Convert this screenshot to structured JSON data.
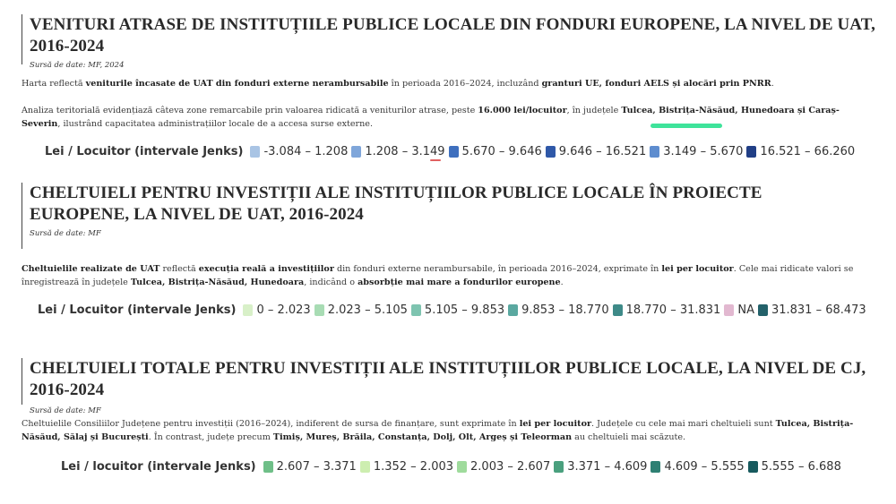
{
  "s1": {
    "title": "VENITURI ATRASE DE INSTITUȚIILE PUBLICE LOCALE DIN FONDURI EUROPENE, LA NIVEL DE UAT, 2016-2024",
    "source": "Sursă de date: MF, 2024",
    "p1": [
      "Harta reflectă ",
      "veniturile încasate de UAT din fonduri externe nerambursabile",
      " în perioada 2016–2024, incluzând ",
      "granturi UE, fonduri AELS și alocări prin PNRR",
      "."
    ],
    "p2": [
      "Analiza teritorială evidențiază câteva zone remarcabile prin valoarea ridicată a veniturilor atrase, peste ",
      "16.000 lei/locuitor",
      ", în județele ",
      "Tulcea, Bistrița-Năsăud, Hunedoara și Caraș-Severin",
      ", ilustrând capacitatea administrațiilor locale de a accesa surse externe."
    ],
    "legend_title": "Lei / Locuitor (intervale Jenks)",
    "legend": [
      {
        "label": "-3.084 – 1.208",
        "color": "#a9c4e4"
      },
      {
        "label": "1.208 – 3.149",
        "color": "#7fa6da"
      },
      {
        "label": "5.670 – 9.646",
        "color": "#3e6fbe"
      },
      {
        "label": "9.646 – 16.521",
        "color": "#2f58a8"
      },
      {
        "label": "3.149 – 5.670",
        "color": "#5e8dcf"
      },
      {
        "label": "16.521 – 66.260",
        "color": "#213f86"
      }
    ]
  },
  "s2": {
    "title": "CHELTUIELI PENTRU INVESTIȚII ALE INSTITUȚIILOR PUBLICE LOCALE ÎN PROIECTE EUROPENE, LA NIVEL DE UAT, 2016-2024",
    "source": "Sursă de date: MF",
    "p1": [
      "Cheltuielile realizate de UAT",
      " reflectă ",
      "execuția reală a investițiilor",
      " din fonduri externe nerambursabile, în perioada 2016–2024, exprimate în ",
      "lei per locuitor",
      ". Cele mai ridicate valori se înregistrează în județele ",
      "Tulcea, Bistrița-Năsăud, Hunedoara",
      ", indicând o ",
      "absorbție mai mare a fondurilor europene",
      "."
    ],
    "legend_title": "Lei / Locuitor (intervale Jenks)",
    "legend": [
      {
        "label": "0 – 2.023",
        "color": "#d8f0c8"
      },
      {
        "label": "2.023 – 5.105",
        "color": "#a8dcb4"
      },
      {
        "label": "5.105 – 9.853",
        "color": "#7ec4b0"
      },
      {
        "label": "9.853 – 18.770",
        "color": "#5aa8a0"
      },
      {
        "label": "18.770 – 31.831",
        "color": "#3e8a88"
      },
      {
        "label": "NA",
        "color": "#e2b8d0"
      },
      {
        "label": "31.831 – 68.473",
        "color": "#23616a"
      }
    ]
  },
  "s3": {
    "title": "CHELTUIELI TOTALE PENTRU INVESTIȚII ALE INSTITUȚIILOR PUBLICE LOCALE, LA NIVEL DE CJ, 2016-2024",
    "source": "Sursă de date: MF",
    "p1": [
      "Cheltuielile Consiliilor Județene pentru investiții (2016–2024), indiferent de sursa de finanțare, sunt exprimate în ",
      "lei per locuitor",
      ". Județele cu cele mai mari cheltuieli sunt ",
      "Tulcea, Bistrița-Năsăud, Sălaj și București",
      ". În contrast, județe precum ",
      "Timiș, Mureș, Brăila, Constanța, Dolj, Olt, Argeș și Teleorman",
      " au cheltuieli mai scăzute."
    ],
    "legend_title": "Lei / locuitor (intervale Jenks)",
    "legend": [
      {
        "label": "2.607 – 3.371",
        "color": "#6fbf88"
      },
      {
        "label": "1.352 – 2.003",
        "color": "#cdeeb0"
      },
      {
        "label": "2.003 – 2.607",
        "color": "#9fdb9c"
      },
      {
        "label": "3.371 – 4.609",
        "color": "#4aa07e"
      },
      {
        "label": "4.609 – 5.555",
        "color": "#2e8073"
      },
      {
        "label": "5.555 – 6.688",
        "color": "#175a5e"
      }
    ]
  }
}
